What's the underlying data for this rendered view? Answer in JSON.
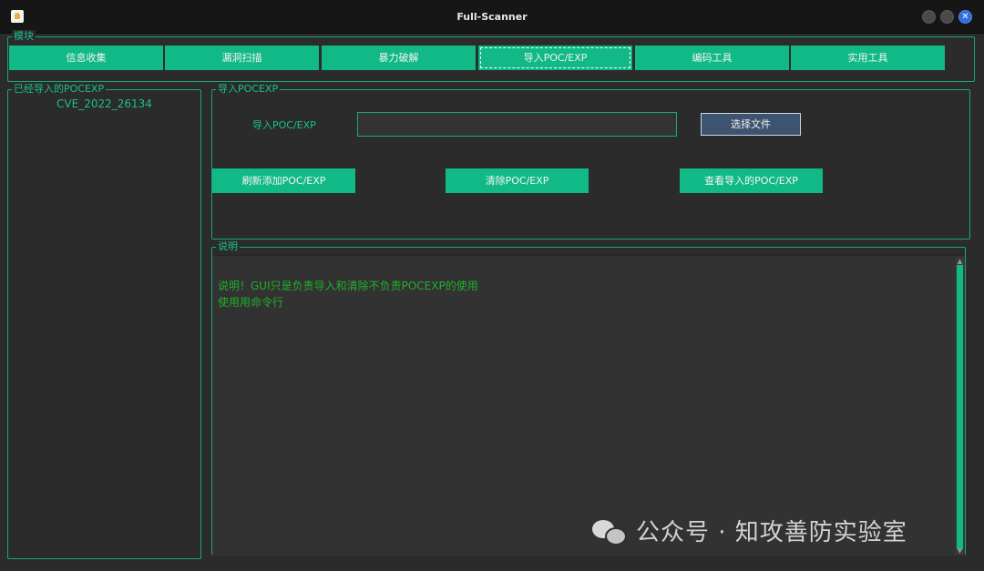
{
  "window": {
    "title": "Full-Scanner",
    "close_glyph": "✕"
  },
  "modules": {
    "legend": "模块",
    "tabs": [
      {
        "label": "信息收集"
      },
      {
        "label": "漏洞扫描"
      },
      {
        "label": "暴力破解"
      },
      {
        "label": "导入POC/EXP"
      },
      {
        "label": "编码工具"
      },
      {
        "label": "实用工具"
      }
    ],
    "active_tab": "导入POC/EXP"
  },
  "imported_panel": {
    "legend": "已经导入的POCEXP",
    "items": [
      "CVE_2022_26134"
    ]
  },
  "import_panel": {
    "legend": "导入POCEXP",
    "field_label": "导入POC/EXP",
    "field_value": "",
    "choose_button": "选择文件",
    "refresh_button": "刷新添加POC/EXP",
    "clear_button": "清除POC/EXP",
    "view_button": "查看导入的POC/EXP"
  },
  "description_panel": {
    "legend": "说明",
    "lines": [
      "说明！GUI只是负责导入和清除不负责POCEXP的使用",
      "使用用命令行"
    ]
  },
  "watermark": {
    "text": "公众号 · 知攻善防实验室",
    "icon": "wechat-icon"
  },
  "colors": {
    "accent": "#10b985",
    "text_green": "#19c08f",
    "desc_text": "#1fb02a",
    "background": "#2b2b2b"
  }
}
